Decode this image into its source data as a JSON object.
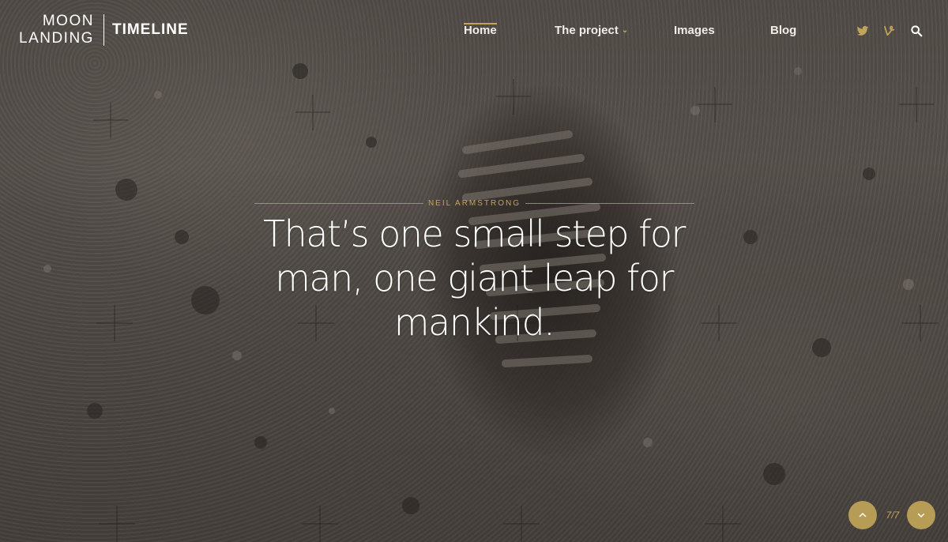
{
  "logo": {
    "line1": "MOON",
    "line2": "LANDING",
    "wordmark": "TIMELINE"
  },
  "nav": {
    "items": [
      {
        "label": "Home"
      },
      {
        "label": "The project"
      },
      {
        "label": "Images"
      },
      {
        "label": "Blog"
      }
    ],
    "active": "Home"
  },
  "icons": {
    "twitter": "twitter-icon",
    "vine": "vine-icon",
    "search": "search-icon",
    "dropdown": "chevron-down-icon",
    "pager_up": "chevron-up-icon",
    "pager_down": "chevron-down-icon"
  },
  "hero": {
    "kicker": "Neil Armstrong",
    "quote": "That’s one small step for man, one giant leap for mankind."
  },
  "pager": {
    "counter": "7/7"
  },
  "colors": {
    "accent": "#c1a45a",
    "button": "#b79c55",
    "text": "#ffffff"
  }
}
